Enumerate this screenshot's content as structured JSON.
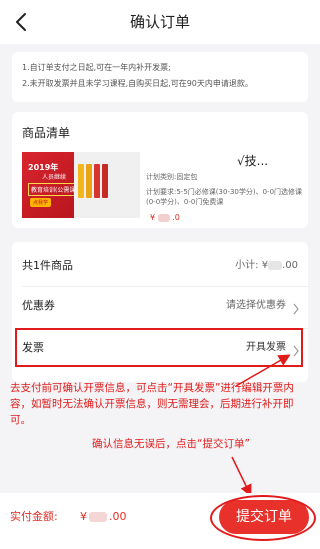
{
  "header": {
    "title": "确认订单",
    "back_icon": "chevron-left-icon"
  },
  "notice": {
    "line1": "1.自订单支付之日起,可在一年内补开发票;",
    "line2": "2.未开取发票并且未学习课程,自购买日起,可在90天内申请退款。"
  },
  "goods": {
    "section_title": "商品清单",
    "name_visible": "√技...",
    "info_type": "计划类别:固定包",
    "info_requirement": "计划要求:5-5门必修课(30-30学分)、0-0门选修课(0-0学分)、0-0门免费课",
    "price_prefix": "¥",
    "price_suffix": ".0",
    "thumbnail": {
      "year": "2019年",
      "line1": "人员继续",
      "line2": "教育培训(公需课)",
      "badge": "点我学"
    }
  },
  "summary": {
    "count_label": "共1件商品",
    "subtotal_label": "小计:",
    "subtotal_prefix": "¥",
    "subtotal_suffix": ".00",
    "coupon_label": "优惠券",
    "coupon_value": "请选择优惠券",
    "invoice_label": "发票",
    "invoice_value": "开具发票"
  },
  "annotations": {
    "invoice_tip": "去支付前可确认开票信息，可点击“开具发票”进行编辑开票内容，如暂时无法确认开票信息，则无需理会，后期进行补开即可。",
    "submit_tip": "确认信息无误后，点击“提交订单”"
  },
  "bottom_bar": {
    "total_label": "实付金额:",
    "total_prefix": "¥",
    "total_suffix": ".00",
    "submit_label": "提交订单"
  },
  "colors": {
    "accent": "#e8312a",
    "annotation": "#e11b1b",
    "background": "#f4f4f6"
  }
}
